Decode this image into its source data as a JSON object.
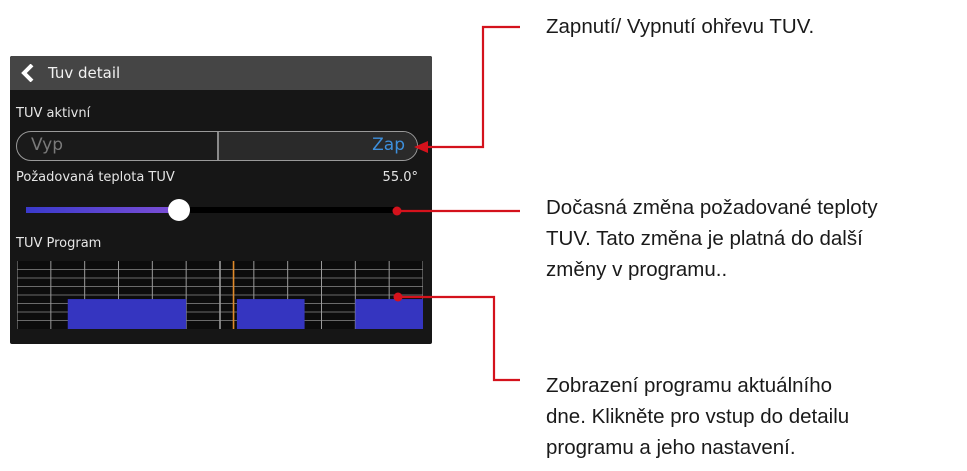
{
  "header": {
    "title": "Tuv detail",
    "back_icon": "chevron-left-icon"
  },
  "tuv_active": {
    "label": "TUV aktivní",
    "off_label": "Vyp",
    "on_label": "Zap",
    "selected": "Zap"
  },
  "temperature": {
    "label": "Požadovaná teplota TUV",
    "value_text": "55.0°",
    "slider_fraction": 0.41
  },
  "program": {
    "label": "TUV Program",
    "hours": 24,
    "current_hour": 12.8,
    "active_blocks": [
      [
        3,
        10
      ],
      [
        13,
        17
      ],
      [
        20,
        24
      ]
    ]
  },
  "annotations": {
    "toggle_note": "Zapnutí/ Vypnutí ohřevu TUV.",
    "slider_note": "Dočasná změna požadované teploty\nTUV. Tato změna je platná do další\nzměny v programu..",
    "program_note": "Zobrazení programu aktuálního\ndne. Klikněte pro vstup do detailu\nprogramu a jeho nastavení."
  },
  "colors": {
    "panel_bg": "#161616",
    "titlebar_bg": "#454545",
    "accent_on": "#3d8fdc",
    "program_block": "#3535c0",
    "current_time_line": "#e08a2a",
    "callout_line": "#d4121c"
  }
}
